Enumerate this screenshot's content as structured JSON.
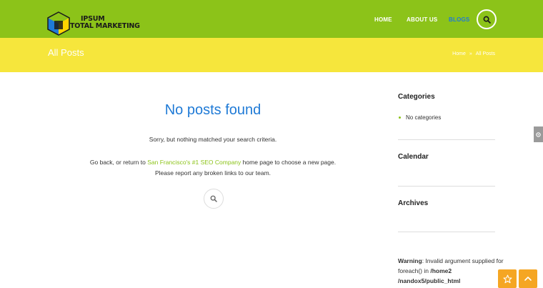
{
  "header": {
    "logo_line1": "IPSUM",
    "logo_line2": "TOTAL MARKETING",
    "nav": [
      {
        "label": "HOME"
      },
      {
        "label": "ABOUT US"
      },
      {
        "label": "BLOGS",
        "active": true
      }
    ],
    "search_icon": "search-icon",
    "colors": {
      "bar": "#8cc319",
      "active": "#1f7ad6"
    }
  },
  "titlebar": {
    "title": "All Posts",
    "breadcrumb": [
      "Home",
      "All Posts"
    ],
    "separator": "»",
    "color": "#f6e63c"
  },
  "main": {
    "heading": "No posts found",
    "sorry": "Sorry, but nothing matched your search criteria.",
    "go_back_prefix": "Go back, or return to ",
    "link_text": "San Francisco's #1 SEO Company",
    "go_back_suffix": " home page to choose a new page.",
    "report": "Please report any broken links to our team."
  },
  "sidebar": {
    "categories_title": "Categories",
    "no_categories": "No categories",
    "calendar_title": "Calendar",
    "archives_title": "Archives",
    "warning_label": "Warning",
    "warning_text": ": Invalid argument supplied for foreach() in ",
    "warning_path": "/home2 /nandox5/public_html"
  },
  "floating": {
    "star_icon": "star-icon",
    "up_icon": "chevron-up-icon",
    "color": "#f5a623"
  }
}
